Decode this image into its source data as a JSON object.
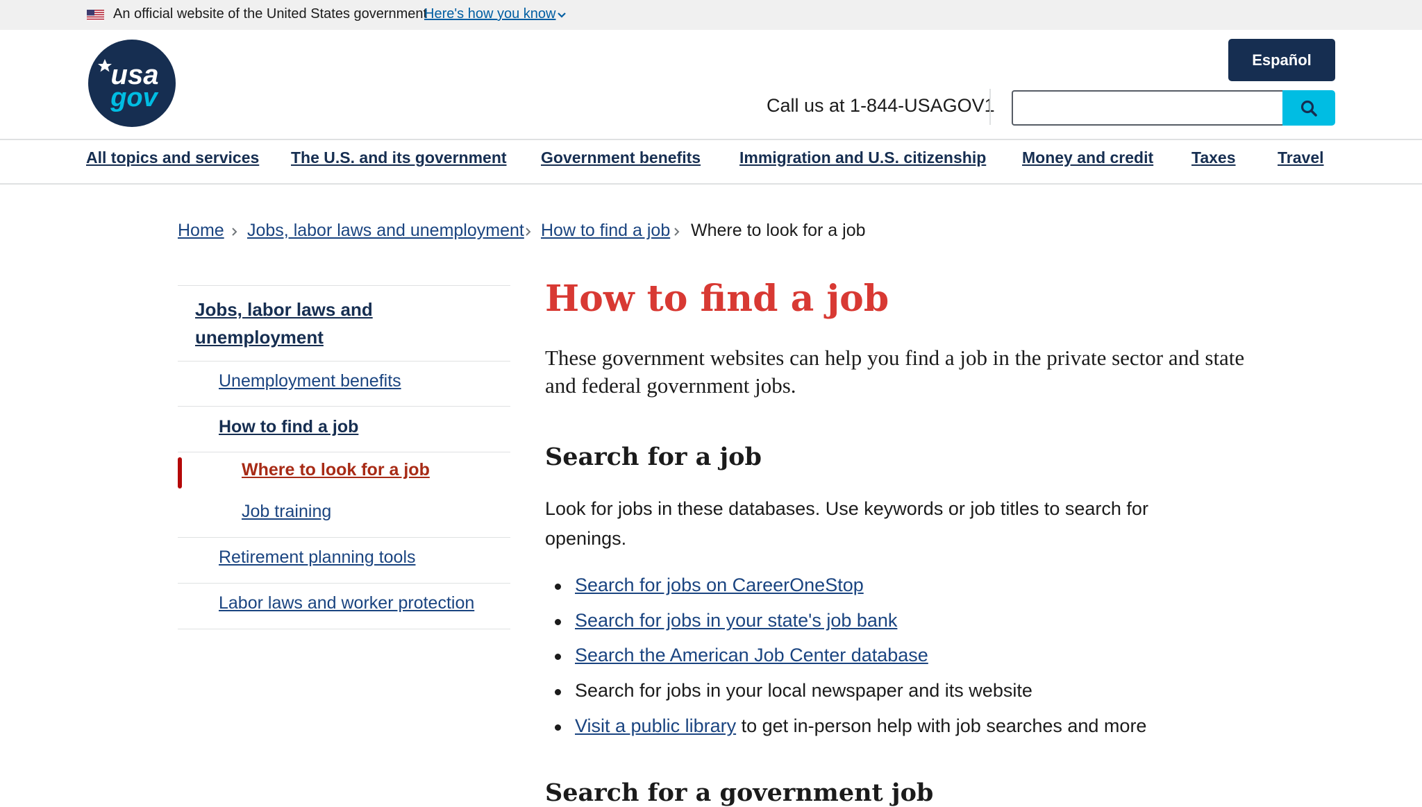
{
  "banner": {
    "official_text": "An official website of the United States government",
    "how_link": "Here's how you know"
  },
  "header": {
    "logo_alt": "USAGov",
    "espanol_label": "Español",
    "call_text": "Call us at 1-844-USAGOV1",
    "search_value": "",
    "search_button_icon": "search-icon"
  },
  "nav": {
    "items": [
      "All topics and services",
      "The U.S. and its government",
      "Government benefits",
      "Immigration and U.S. citizenship",
      "Money and credit",
      "Taxes",
      "Travel"
    ]
  },
  "breadcrumb": {
    "items": [
      "Home",
      "Jobs, labor laws and unemployment",
      "How to find a job"
    ],
    "current": "Where to look for a job"
  },
  "sidenav": {
    "parent": "Jobs, labor laws and unemployment",
    "items": [
      "Unemployment benefits",
      "How to find a job",
      "Where to look for a job",
      "Job training",
      "Retirement planning tools",
      "Labor laws and worker protection"
    ]
  },
  "main": {
    "title": "How to find a job",
    "intro": "These government websites can help you find a job in the private sector and state and federal government jobs.",
    "section1_heading": "Search for a job",
    "section1_text": "Look for jobs in these databases. Use keywords or job titles to search for openings.",
    "list": [
      "Search for jobs on CareerOneStop",
      "Search for jobs in your state's job bank",
      "Search the American Job Center database",
      "Search for jobs in your local newspaper and its website",
      "Visit a public library",
      " to get in-person help with job searches and more"
    ],
    "section2_heading": "Search for a government job"
  },
  "colors": {
    "navy": "#162e51",
    "link": "#1a4480",
    "title_red": "#d83933",
    "current_red": "#a72a15",
    "search_cyan": "#00bde3"
  }
}
